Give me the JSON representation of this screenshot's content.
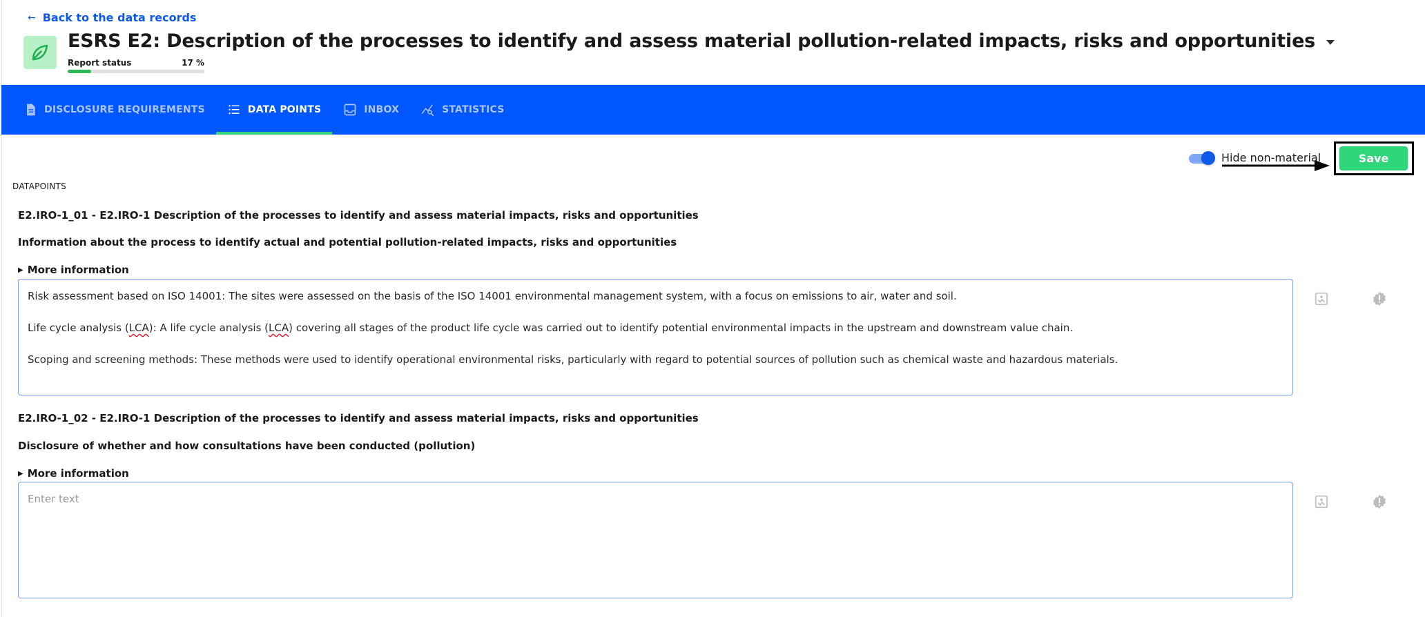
{
  "header": {
    "back_label": "Back to the data records",
    "title": "ESRS E2: Description of the processes to identify and assess material pollution-related impacts, risks and opportunities",
    "status_label": "Report status",
    "status_value": "17 %",
    "progress_percent": 17,
    "app_icon": "leaf-icon",
    "brand_green": "#2eb85c"
  },
  "tabs": [
    {
      "label": "DISCLOSURE REQUIREMENTS",
      "icon": "document-icon",
      "active": false
    },
    {
      "label": "DATA POINTS",
      "icon": "list-icon",
      "active": true
    },
    {
      "label": "INBOX",
      "icon": "inbox-icon",
      "active": false
    },
    {
      "label": "STATISTICS",
      "icon": "chart-search-icon",
      "active": false
    }
  ],
  "toolbar": {
    "hide_non_material_label": "Hide non-material",
    "hide_non_material_on": true,
    "save_label": "Save"
  },
  "section_label": "DATAPOINTS",
  "datapoints": [
    {
      "code": "E2.IRO-1_01 - E2.IRO-1 Description of the processes to identify and assess material impacts, risks and opportunities",
      "description": "Information about the process to identify actual and potential pollution-related impacts, risks and opportunities",
      "more_info_label": "More information",
      "paragraph_1": "Risk assessment based on ISO 14001: The sites were assessed on the basis of the ISO 14001 environmental management system, with a focus on emissions to air, water and soil.",
      "paragraph_2_a": "Life cycle analysis (",
      "paragraph_2_b": "LCA",
      "paragraph_2_c": "): A life cycle analysis (",
      "paragraph_2_d": "LCA",
      "paragraph_2_e": ") covering all stages of the product life cycle was carried out to identify potential environmental impacts in the upstream and downstream value chain.",
      "paragraph_3": "Scoping and screening methods: These methods were used to identify operational environmental risks, particularly with regard to potential sources of pollution such as chemical waste and hazardous materials."
    },
    {
      "code": "E2.IRO-1_02 - E2.IRO-1 Description of the processes to identify and assess material impacts, risks and opportunities",
      "description": "Disclosure of whether and how consultations have been conducted (pollution)",
      "more_info_label": "More information",
      "placeholder": "Enter text"
    }
  ],
  "side_icons": [
    "attachment-icon",
    "alert-badge-icon"
  ]
}
